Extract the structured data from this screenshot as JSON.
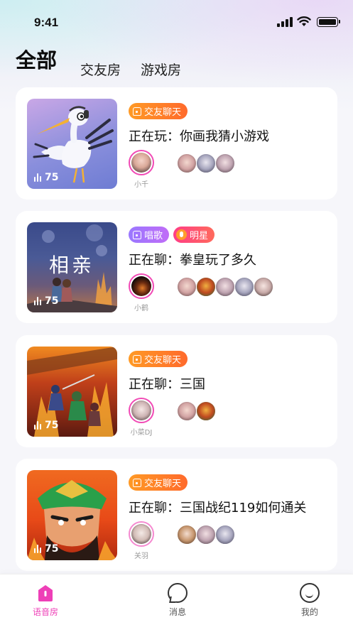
{
  "status_bar": {
    "time": "9:41"
  },
  "tabs": [
    {
      "label": "全部",
      "active": true
    },
    {
      "label": "交友房",
      "active": false
    },
    {
      "label": "游戏房",
      "active": false
    }
  ],
  "rooms": [
    {
      "badges": [
        {
          "label": "交友聊天",
          "style": "orange",
          "icon": "home-icon"
        }
      ],
      "topic": "正在玩：你画我猜小游戏",
      "listeners": "75",
      "host_name": "小千",
      "member_count": 3
    },
    {
      "badges": [
        {
          "label": "唱歌",
          "style": "purple",
          "icon": "home-icon"
        },
        {
          "label": "明星",
          "style": "red",
          "icon": "mic-icon"
        }
      ],
      "thumb_text": "相亲",
      "topic": "正在聊：拳皇玩了多久",
      "listeners": "75",
      "host_name": "小鹤",
      "member_count": 5
    },
    {
      "badges": [
        {
          "label": "交友聊天",
          "style": "orange",
          "icon": "home-icon"
        }
      ],
      "topic": "正在聊：三国",
      "listeners": "75",
      "host_name": "小菜DJ",
      "member_count": 2
    },
    {
      "badges": [
        {
          "label": "交友聊天",
          "style": "orange",
          "icon": "home-icon"
        }
      ],
      "topic": "正在聊：三国战纪119如何通关",
      "listeners": "75",
      "host_name": "关羽",
      "member_count": 3
    }
  ],
  "bottom_nav": [
    {
      "label": "语音房",
      "icon": "voice-room-icon",
      "active": true
    },
    {
      "label": "消息",
      "icon": "message-icon",
      "active": false
    },
    {
      "label": "我的",
      "icon": "profile-icon",
      "active": false
    }
  ],
  "colors": {
    "accent_pink": "#ee3fb7",
    "badge_orange": "#ff7a2a",
    "badge_purple": "#a474fb",
    "badge_red": "#ff4a78"
  }
}
